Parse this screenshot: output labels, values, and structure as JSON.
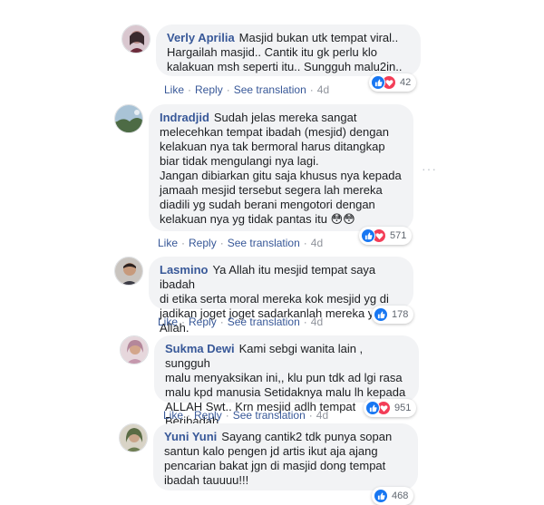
{
  "labels": {
    "like": "Like",
    "reply": "Reply",
    "see_translation": "See translation"
  },
  "colors": {
    "link": "#385898",
    "bubble": "#f2f3f5",
    "like": "#1877f2",
    "love": "#f33e58",
    "meta": "#90949c"
  },
  "comments": [
    {
      "name": "Verly Aprilia",
      "text": "Masjid bukan utk tempat viral..\nHargailah masjid.. Cantik itu gk perlu klo\nkalakuan msh seperti itu.. Sungguh malu2in..",
      "age": "4d",
      "reactions": [
        "like",
        "love"
      ],
      "count": "42"
    },
    {
      "name": "Indradjid",
      "text": "Sudah jelas mereka sangat\nmelecehkan tempat ibadah (mesjid) dengan\nkelakuan nya tak bermoral harus ditangkap\nbiar tidak mengulangi nya lagi.\nJangan dibiarkan gitu saja khusus nya kepada\njamaah mesjid tersebut segera lah mereka\ndiadili yg sudah berani mengotori dengan\nkelakuan nya yg tidak pantas itu 😳😳",
      "age": "4d",
      "reactions": [
        "like",
        "love"
      ],
      "count": "571"
    },
    {
      "name": "Lasmino",
      "text": "Ya Allah itu mesjid tempat saya ibadah\ndi etika serta moral mereka kok mesjid yg di\njadikan joget joget sadarkanlah mereka ya Allah.",
      "age": "4d",
      "reactions": [
        "like"
      ],
      "count": "178"
    },
    {
      "name": "Sukma Dewi",
      "text": "Kami sebgi wanita lain , sungguh\nmalu menyaksikan ini,, klu pun tdk ad lgi rasa\nmalu kpd manusia Setidaknya malu lh kepada\nALLAH Swt.. Krn mesjid adlh tempat Beribadah.",
      "age": "4d",
      "reactions": [
        "like",
        "love"
      ],
      "count": "951"
    },
    {
      "name": "Yuni Yuni",
      "text": "Sayang cantik2 tdk punya sopan\nsantun kalo pengen jd artis ikut aja ajang\npencarian bakat jgn di masjid dong tempat\nibadah tauuuu!!!",
      "age": "",
      "reactions": [
        "like"
      ],
      "count": "468"
    }
  ]
}
